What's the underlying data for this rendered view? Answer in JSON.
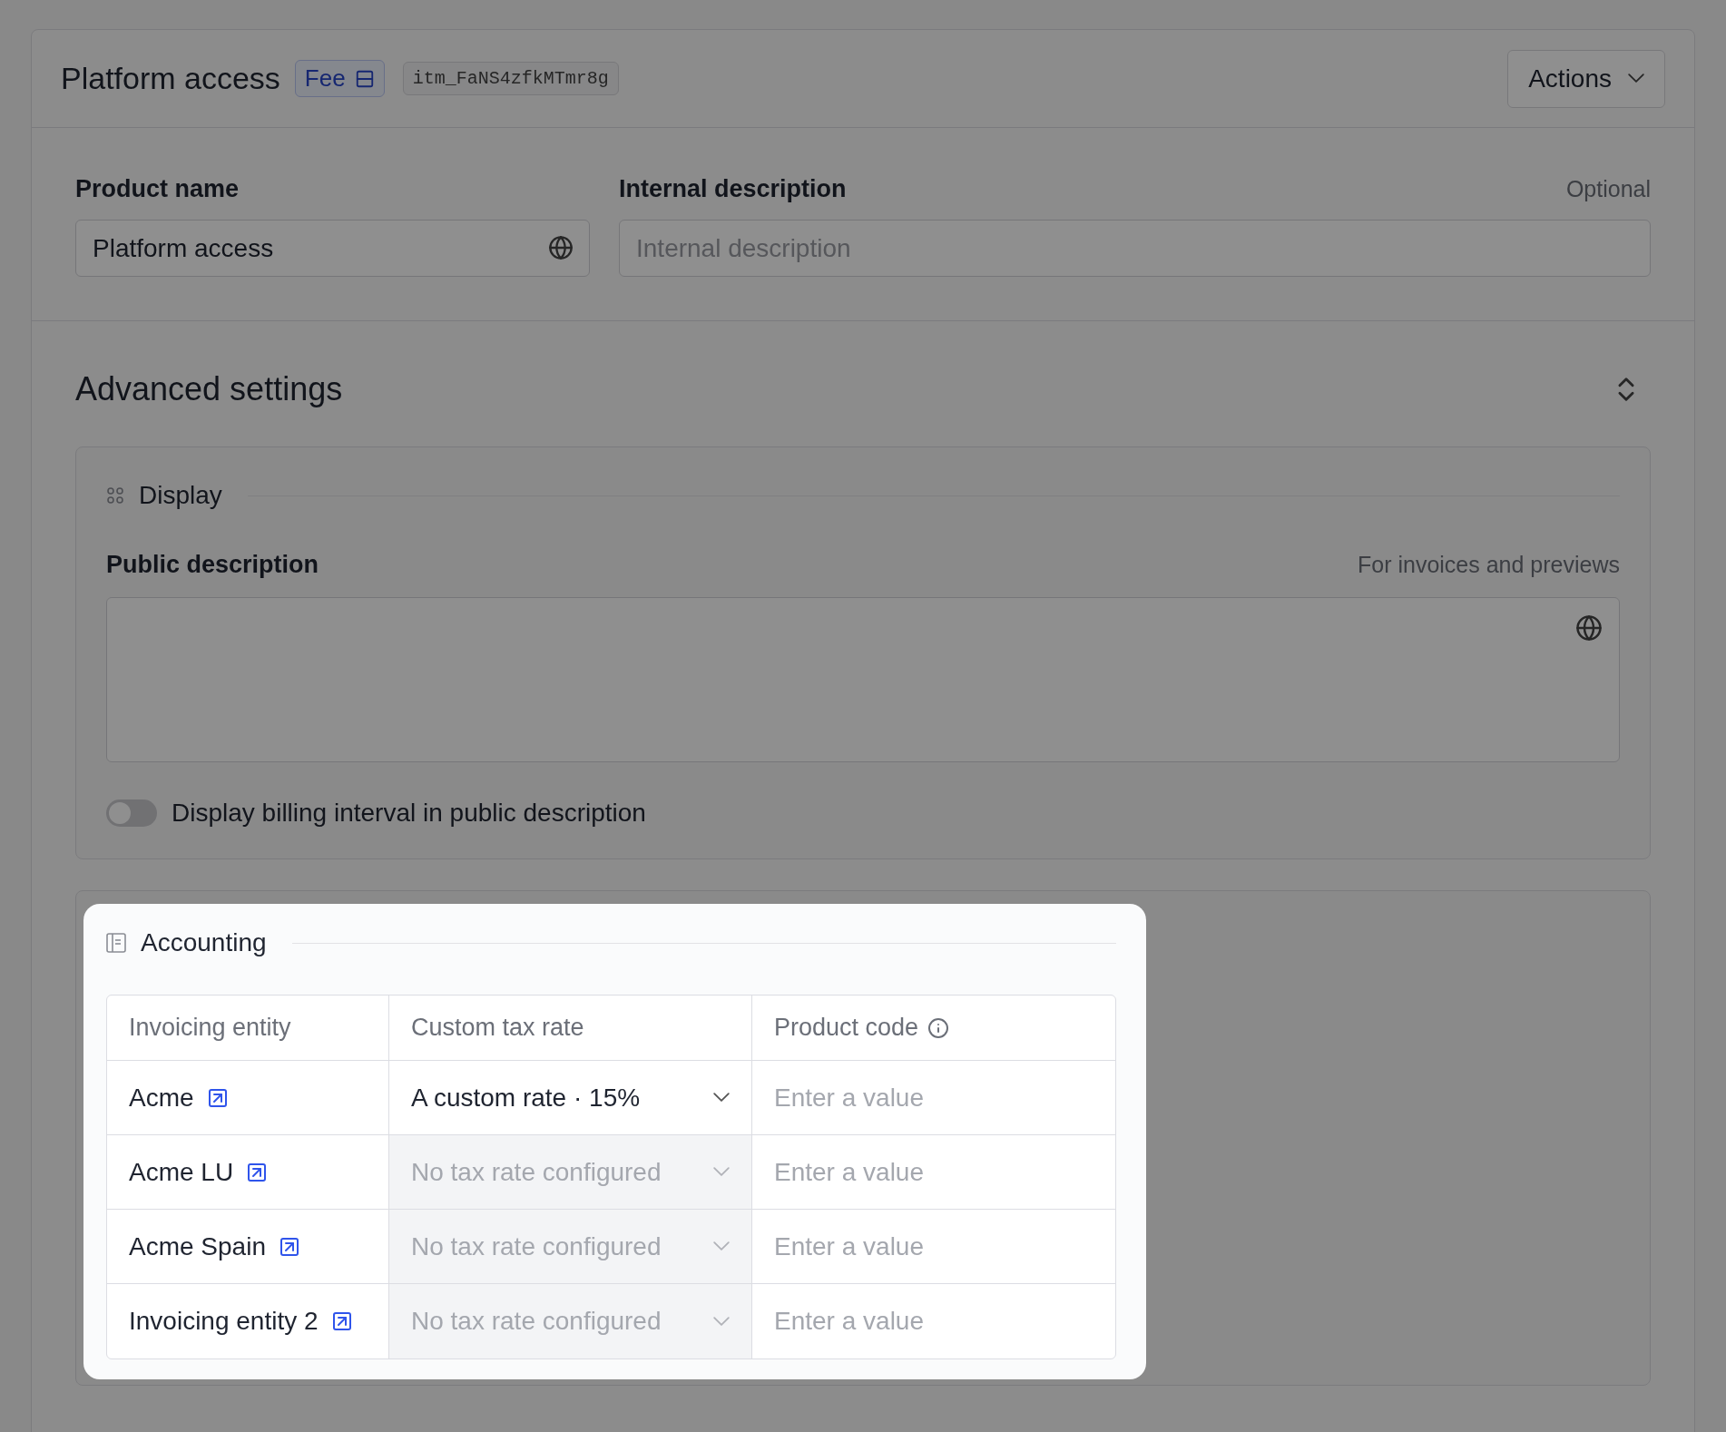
{
  "header": {
    "title": "Platform access",
    "badge": "Fee",
    "id_tag": "itm_FaNS4zfkMTmr8g",
    "actions_button": "Actions"
  },
  "fields": [
    {
      "label": "Product name",
      "value": "Platform access"
    },
    {
      "label": "Internal description",
      "hint": "Optional",
      "placeholder": "Internal description"
    }
  ],
  "advanced_settings": {
    "title": "Advanced settings"
  },
  "display": {
    "title": "Display",
    "public_description": {
      "label": "Public description",
      "hint": "For invoices and previews"
    },
    "toggle": {
      "label": "Display billing interval in public description",
      "on": false
    }
  },
  "accounting": {
    "title": "Accounting",
    "columns": [
      {
        "label": "Invoicing entity",
        "info": false
      },
      {
        "label": "Custom tax rate",
        "info": false
      },
      {
        "label": "Product code",
        "info": true
      }
    ],
    "rows": [
      {
        "entity": "Acme",
        "tax_rate": "A custom rate · 15%",
        "disabled": false,
        "product_code_placeholder": "Enter a value"
      },
      {
        "entity": "Acme LU",
        "tax_rate": "No tax rate configured",
        "disabled": true,
        "product_code_placeholder": "Enter a value"
      },
      {
        "entity": "Acme Spain",
        "tax_rate": "No tax rate configured",
        "disabled": true,
        "product_code_placeholder": "Enter a value"
      },
      {
        "entity": "Invoicing entity 2",
        "tax_rate": "No tax rate configured",
        "disabled": true,
        "product_code_placeholder": "Enter a value"
      }
    ]
  }
}
